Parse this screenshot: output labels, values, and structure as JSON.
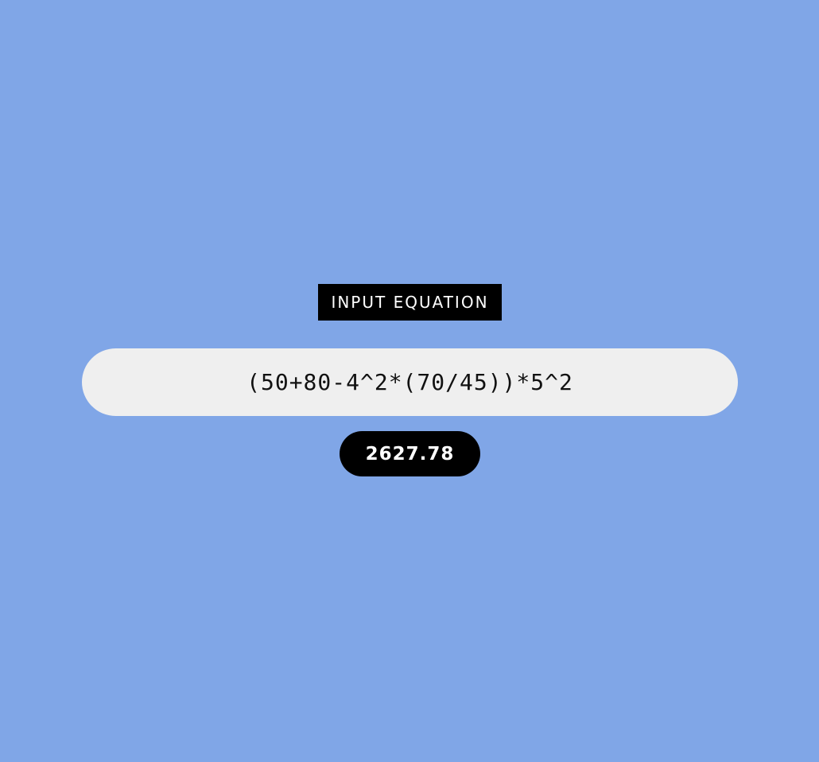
{
  "header": {
    "title": "INPUT EQUATION"
  },
  "equation": {
    "value": "(50+80-4^2*(70/45))*5^2"
  },
  "result": {
    "value": "2627.78"
  },
  "colors": {
    "background": "#80a6e7",
    "title_bg": "#000000",
    "input_bg": "#efefef",
    "result_bg": "#000000"
  }
}
